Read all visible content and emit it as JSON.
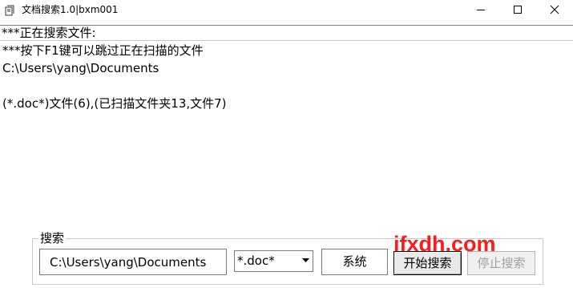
{
  "window": {
    "title": "文档搜索1.0|bxm001"
  },
  "status": {
    "text": "***正在搜索文件:"
  },
  "output": {
    "hint": "***按下F1键可以跳过正在扫描的文件",
    "current_path": "C:\\Users\\yang\\Documents",
    "result": "(*.doc*)文件(6),(已扫描文件夹13,文件7)"
  },
  "search": {
    "group_label": "搜索",
    "path_value": "C:\\Users\\yang\\Documents",
    "extension_selected": "*.doc*",
    "system_label": "系统",
    "start_label": "开始搜索",
    "stop_label": "停止搜索"
  },
  "watermark": "ifxdh.com",
  "icons": {
    "app": "document-search-app-icon",
    "minimize": "minimize-icon",
    "maximize": "maximize-icon",
    "close": "close-icon",
    "dropdown": "chevron-down-icon"
  },
  "colors": {
    "watermark": "#ff1a1a",
    "disabled_text": "#a0a0a0"
  }
}
